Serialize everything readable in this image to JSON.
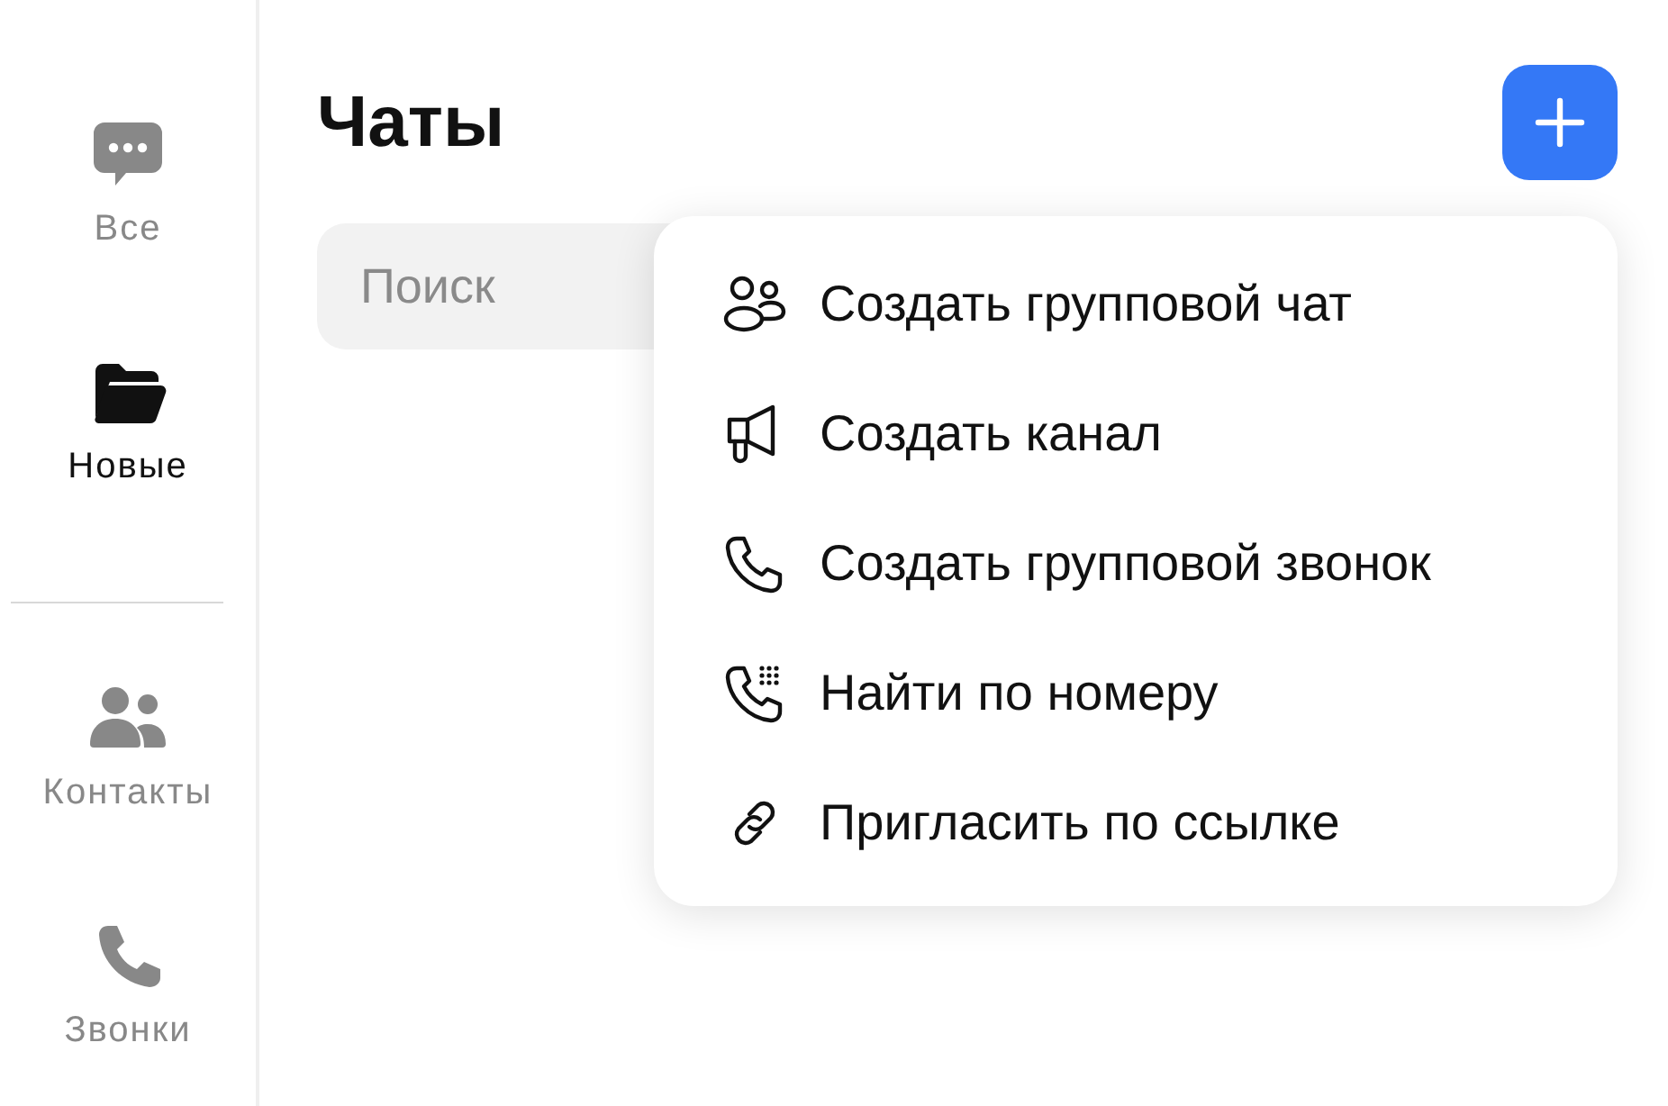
{
  "sidebar": {
    "groups": [
      {
        "items": [
          {
            "label": "Все",
            "selected": false
          },
          {
            "label": "Новые",
            "selected": true
          }
        ]
      },
      {
        "items": [
          {
            "label": "Контакты",
            "selected": false
          },
          {
            "label": "Звонки",
            "selected": false
          }
        ]
      }
    ]
  },
  "header": {
    "title": "Чаты"
  },
  "search": {
    "placeholder": "Поиск"
  },
  "menu": {
    "items": [
      {
        "label": "Создать групповой чат"
      },
      {
        "label": "Создать канал"
      },
      {
        "label": "Создать групповой звонок"
      },
      {
        "label": "Найти по номеру"
      },
      {
        "label": "Пригласить по ссылке"
      }
    ]
  }
}
